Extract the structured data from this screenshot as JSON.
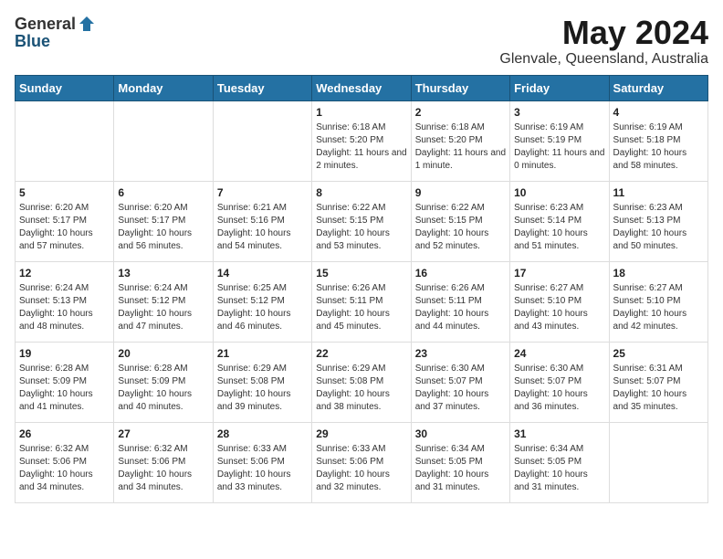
{
  "logo": {
    "general": "General",
    "blue": "Blue"
  },
  "title": "May 2024",
  "location": "Glenvale, Queensland, Australia",
  "days_of_week": [
    "Sunday",
    "Monday",
    "Tuesday",
    "Wednesday",
    "Thursday",
    "Friday",
    "Saturday"
  ],
  "weeks": [
    [
      {
        "day": "",
        "sunrise": "",
        "sunset": "",
        "daylight": ""
      },
      {
        "day": "",
        "sunrise": "",
        "sunset": "",
        "daylight": ""
      },
      {
        "day": "",
        "sunrise": "",
        "sunset": "",
        "daylight": ""
      },
      {
        "day": "1",
        "sunrise": "Sunrise: 6:18 AM",
        "sunset": "Sunset: 5:20 PM",
        "daylight": "Daylight: 11 hours and 2 minutes."
      },
      {
        "day": "2",
        "sunrise": "Sunrise: 6:18 AM",
        "sunset": "Sunset: 5:20 PM",
        "daylight": "Daylight: 11 hours and 1 minute."
      },
      {
        "day": "3",
        "sunrise": "Sunrise: 6:19 AM",
        "sunset": "Sunset: 5:19 PM",
        "daylight": "Daylight: 11 hours and 0 minutes."
      },
      {
        "day": "4",
        "sunrise": "Sunrise: 6:19 AM",
        "sunset": "Sunset: 5:18 PM",
        "daylight": "Daylight: 10 hours and 58 minutes."
      }
    ],
    [
      {
        "day": "5",
        "sunrise": "Sunrise: 6:20 AM",
        "sunset": "Sunset: 5:17 PM",
        "daylight": "Daylight: 10 hours and 57 minutes."
      },
      {
        "day": "6",
        "sunrise": "Sunrise: 6:20 AM",
        "sunset": "Sunset: 5:17 PM",
        "daylight": "Daylight: 10 hours and 56 minutes."
      },
      {
        "day": "7",
        "sunrise": "Sunrise: 6:21 AM",
        "sunset": "Sunset: 5:16 PM",
        "daylight": "Daylight: 10 hours and 54 minutes."
      },
      {
        "day": "8",
        "sunrise": "Sunrise: 6:22 AM",
        "sunset": "Sunset: 5:15 PM",
        "daylight": "Daylight: 10 hours and 53 minutes."
      },
      {
        "day": "9",
        "sunrise": "Sunrise: 6:22 AM",
        "sunset": "Sunset: 5:15 PM",
        "daylight": "Daylight: 10 hours and 52 minutes."
      },
      {
        "day": "10",
        "sunrise": "Sunrise: 6:23 AM",
        "sunset": "Sunset: 5:14 PM",
        "daylight": "Daylight: 10 hours and 51 minutes."
      },
      {
        "day": "11",
        "sunrise": "Sunrise: 6:23 AM",
        "sunset": "Sunset: 5:13 PM",
        "daylight": "Daylight: 10 hours and 50 minutes."
      }
    ],
    [
      {
        "day": "12",
        "sunrise": "Sunrise: 6:24 AM",
        "sunset": "Sunset: 5:13 PM",
        "daylight": "Daylight: 10 hours and 48 minutes."
      },
      {
        "day": "13",
        "sunrise": "Sunrise: 6:24 AM",
        "sunset": "Sunset: 5:12 PM",
        "daylight": "Daylight: 10 hours and 47 minutes."
      },
      {
        "day": "14",
        "sunrise": "Sunrise: 6:25 AM",
        "sunset": "Sunset: 5:12 PM",
        "daylight": "Daylight: 10 hours and 46 minutes."
      },
      {
        "day": "15",
        "sunrise": "Sunrise: 6:26 AM",
        "sunset": "Sunset: 5:11 PM",
        "daylight": "Daylight: 10 hours and 45 minutes."
      },
      {
        "day": "16",
        "sunrise": "Sunrise: 6:26 AM",
        "sunset": "Sunset: 5:11 PM",
        "daylight": "Daylight: 10 hours and 44 minutes."
      },
      {
        "day": "17",
        "sunrise": "Sunrise: 6:27 AM",
        "sunset": "Sunset: 5:10 PM",
        "daylight": "Daylight: 10 hours and 43 minutes."
      },
      {
        "day": "18",
        "sunrise": "Sunrise: 6:27 AM",
        "sunset": "Sunset: 5:10 PM",
        "daylight": "Daylight: 10 hours and 42 minutes."
      }
    ],
    [
      {
        "day": "19",
        "sunrise": "Sunrise: 6:28 AM",
        "sunset": "Sunset: 5:09 PM",
        "daylight": "Daylight: 10 hours and 41 minutes."
      },
      {
        "day": "20",
        "sunrise": "Sunrise: 6:28 AM",
        "sunset": "Sunset: 5:09 PM",
        "daylight": "Daylight: 10 hours and 40 minutes."
      },
      {
        "day": "21",
        "sunrise": "Sunrise: 6:29 AM",
        "sunset": "Sunset: 5:08 PM",
        "daylight": "Daylight: 10 hours and 39 minutes."
      },
      {
        "day": "22",
        "sunrise": "Sunrise: 6:29 AM",
        "sunset": "Sunset: 5:08 PM",
        "daylight": "Daylight: 10 hours and 38 minutes."
      },
      {
        "day": "23",
        "sunrise": "Sunrise: 6:30 AM",
        "sunset": "Sunset: 5:07 PM",
        "daylight": "Daylight: 10 hours and 37 minutes."
      },
      {
        "day": "24",
        "sunrise": "Sunrise: 6:30 AM",
        "sunset": "Sunset: 5:07 PM",
        "daylight": "Daylight: 10 hours and 36 minutes."
      },
      {
        "day": "25",
        "sunrise": "Sunrise: 6:31 AM",
        "sunset": "Sunset: 5:07 PM",
        "daylight": "Daylight: 10 hours and 35 minutes."
      }
    ],
    [
      {
        "day": "26",
        "sunrise": "Sunrise: 6:32 AM",
        "sunset": "Sunset: 5:06 PM",
        "daylight": "Daylight: 10 hours and 34 minutes."
      },
      {
        "day": "27",
        "sunrise": "Sunrise: 6:32 AM",
        "sunset": "Sunset: 5:06 PM",
        "daylight": "Daylight: 10 hours and 34 minutes."
      },
      {
        "day": "28",
        "sunrise": "Sunrise: 6:33 AM",
        "sunset": "Sunset: 5:06 PM",
        "daylight": "Daylight: 10 hours and 33 minutes."
      },
      {
        "day": "29",
        "sunrise": "Sunrise: 6:33 AM",
        "sunset": "Sunset: 5:06 PM",
        "daylight": "Daylight: 10 hours and 32 minutes."
      },
      {
        "day": "30",
        "sunrise": "Sunrise: 6:34 AM",
        "sunset": "Sunset: 5:05 PM",
        "daylight": "Daylight: 10 hours and 31 minutes."
      },
      {
        "day": "31",
        "sunrise": "Sunrise: 6:34 AM",
        "sunset": "Sunset: 5:05 PM",
        "daylight": "Daylight: 10 hours and 31 minutes."
      },
      {
        "day": "",
        "sunrise": "",
        "sunset": "",
        "daylight": ""
      }
    ]
  ]
}
